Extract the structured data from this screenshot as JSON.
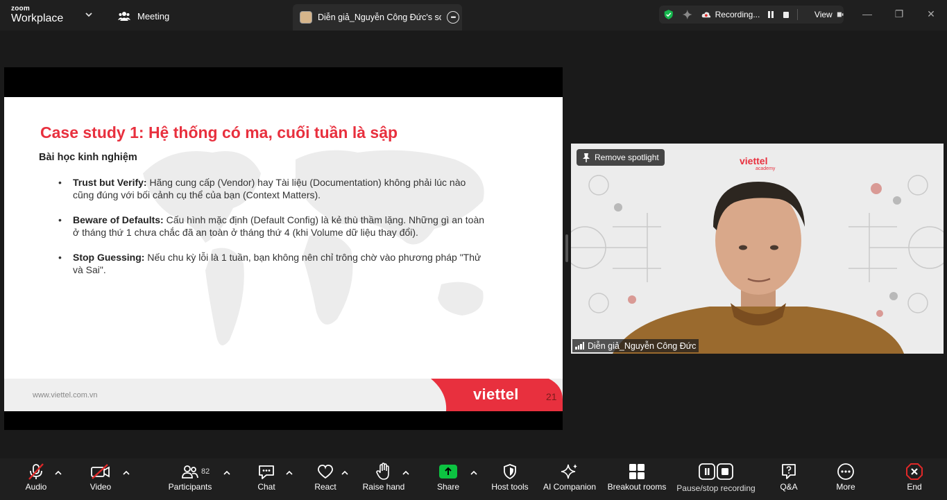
{
  "app": {
    "brand_top": "zoom",
    "brand_bottom": "Workplace"
  },
  "titlebar": {
    "meeting_tab_label": "Meeting",
    "share_tab_label": "Diễn giả_Nguyễn Công Đức's scre",
    "recording_label": "Recording...",
    "view_label": "View"
  },
  "slide": {
    "title": "Case study 1: Hệ thống có ma, cuối tuần là sập",
    "subtitle": "Bài học kinh nghiệm",
    "bullets": [
      {
        "term": "Trust but Verify:",
        "text": " Hãng cung cấp (Vendor) hay Tài liệu (Documentation) không phải lúc nào cũng đúng với bối cảnh cụ thể của bạn (Context Matters)."
      },
      {
        "term": "Beware of Defaults:",
        "text": " Cấu hình mặc định (Default Config) là kẻ thù thầm lặng. Những gì an toàn ở tháng thứ 1 chưa chắc đã an toàn ở tháng thứ 4 (khi Volume dữ liệu thay đổi)."
      },
      {
        "term": "Stop Guessing:",
        "text": " Nếu chu kỳ lỗi là 1 tuần, bạn không nên chỉ trông chờ vào phương pháp \"Thử và Sai\"."
      }
    ],
    "footer_url": "www.viettel.com.vn",
    "footer_logo": "viettel",
    "page_number": "21"
  },
  "video": {
    "spotlight_label": "Remove spotlight",
    "logo": "viettel",
    "logo_sub": "academy",
    "participant_name": "Diễn giả_Nguyễn Công Đức"
  },
  "toolbar": {
    "audio": "Audio",
    "video": "Video",
    "participants": "Participants",
    "participants_count": "82",
    "chat": "Chat",
    "react": "React",
    "raise_hand": "Raise hand",
    "share": "Share",
    "host_tools": "Host tools",
    "ai_companion": "AI Companion",
    "breakout_rooms": "Breakout rooms",
    "pause_stop_recording": "Pause/stop recording",
    "qa": "Q&A",
    "more": "More",
    "end": "End"
  },
  "colors": {
    "accent_red": "#e8303e",
    "share_green": "#0cc341",
    "toolbar_bg": "#1f1f1f",
    "end_red": "#e02828"
  }
}
